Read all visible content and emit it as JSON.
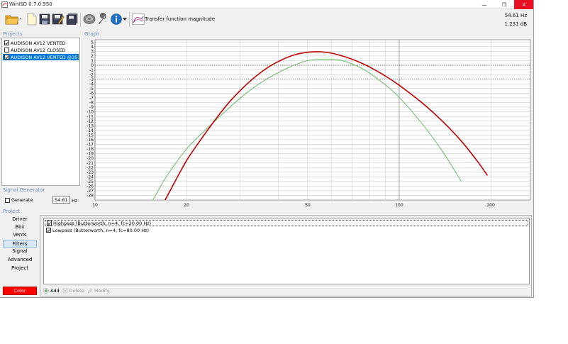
{
  "window": {
    "title": "WinISD 0.7.0.950",
    "buttons": {
      "minimize": "—",
      "maximize": "❐",
      "close": "✕"
    }
  },
  "toolbar": {
    "buttons": [
      "open-folder",
      "new-file",
      "save",
      "save-as",
      "save-all",
      "speaker",
      "tools",
      "info"
    ],
    "plot_label": "Transfer function magnitude",
    "readout_frequency": "54.61 Hz",
    "readout_level": "1.231 dB"
  },
  "projects": {
    "heading": "Projects",
    "items": [
      {
        "label": "AUDISON AV12 VENTED",
        "checked": true,
        "selected": false
      },
      {
        "label": "AUDISON AV12 CLOSED",
        "checked": false,
        "selected": false
      },
      {
        "label": "AUDISON AV12 VENTED @35",
        "checked": true,
        "selected": true
      }
    ]
  },
  "graph": {
    "heading": "Graph"
  },
  "chart_data": {
    "type": "line",
    "xscale": "log",
    "xlim": [
      10,
      270
    ],
    "ylim": [
      -29,
      5.5
    ],
    "x_tick_labels": [
      "10",
      "20",
      "50",
      "100",
      "200"
    ],
    "x_ticks": [
      10,
      20,
      50,
      100,
      200
    ],
    "y_ticks": [
      5,
      4,
      3,
      2,
      1,
      0,
      -1,
      -2,
      -3,
      -4,
      -5,
      -6,
      -7,
      -8,
      -9,
      -10,
      -11,
      -12,
      -13,
      -14,
      -15,
      -16,
      -17,
      -18,
      -19,
      -20,
      -21,
      -22,
      -23,
      -24,
      -25,
      -26,
      -27,
      -28
    ],
    "reference_lines": [
      0,
      -3
    ],
    "grid": true,
    "series": [
      {
        "color": "#c00000",
        "x": [
          17,
          18.5,
          20,
          22,
          25,
          28,
          32,
          36,
          40,
          45,
          50,
          55,
          60,
          65,
          70,
          75,
          80,
          90,
          100,
          120,
          140,
          160,
          180,
          195
        ],
        "y": [
          -29,
          -24.5,
          -20.5,
          -16.5,
          -11.5,
          -7.5,
          -3.7,
          -1,
          0.8,
          2.2,
          2.8,
          2.9,
          2.6,
          2,
          1.3,
          0.5,
          -0.4,
          -2.3,
          -4.3,
          -8.3,
          -12.3,
          -16.3,
          -20.5,
          -23.7
        ]
      },
      {
        "color": "#6ab86a",
        "x": [
          15.5,
          17,
          18.5,
          20,
          22,
          25,
          28,
          32,
          36,
          40,
          45,
          50,
          55,
          60,
          65,
          70,
          75,
          80,
          90,
          100,
          120,
          140,
          160
        ],
        "y": [
          -29,
          -24.4,
          -20.9,
          -18,
          -15.2,
          -11.8,
          -8.8,
          -5.6,
          -3.3,
          -1.6,
          0,
          1,
          1.3,
          1.3,
          1,
          0.3,
          -0.6,
          -1.7,
          -4.2,
          -6.9,
          -12.9,
          -18.9,
          -25
        ]
      }
    ]
  },
  "signal_generator": {
    "heading": "Signal Generator",
    "label": "Generate",
    "checked": false,
    "frequency": "54.61",
    "unit": "Hz"
  },
  "project": {
    "heading": "Project",
    "nav": [
      "Driver",
      "Box",
      "Vents",
      "Filters",
      "Signal",
      "Advanced",
      "Project"
    ],
    "active": "Filters",
    "color_button": "Color"
  },
  "filters": {
    "items": [
      {
        "label": "Highpass (Butterworth, n=4, fc=20.00 Hz)",
        "checked": true
      },
      {
        "label": "Lowpass (Butterworth, n=4, fc=80.00 Hz)",
        "checked": true
      }
    ],
    "actions": {
      "add": "Add",
      "delete": "Delete",
      "modify": "Modify"
    }
  }
}
